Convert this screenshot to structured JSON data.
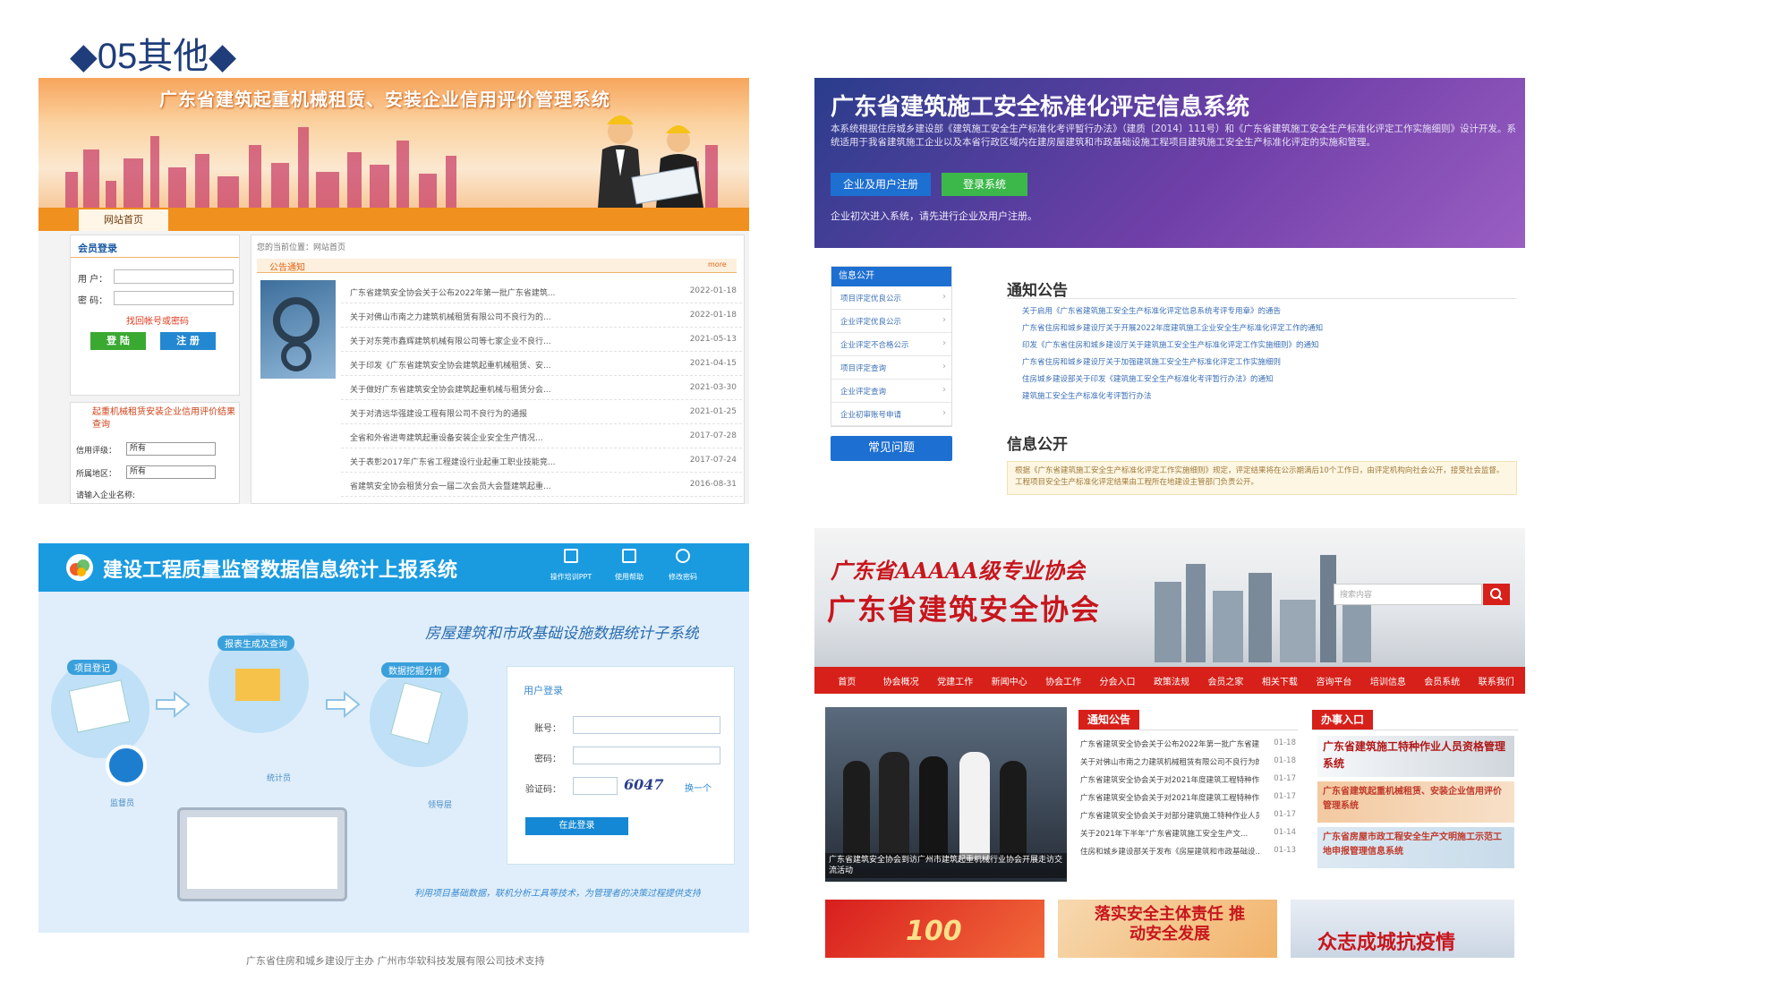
{
  "slide": {
    "title": "◆05其他◆"
  },
  "p1": {
    "banner_title": "广东省建筑起重机械租赁、安装企业信用评价管理系统",
    "nav_tab": "网站首页",
    "login_title": "会员登录",
    "user_label": "用 户：",
    "pwd_label": "密 码：",
    "forgot": "找回帐号或密码",
    "login_btn": "登 陆",
    "register_btn": "注 册",
    "query_title": "起重机械租赁安装企业信用评价结果查询",
    "rating_label": "信用评级：",
    "rating_value": "所有",
    "region_label": "所属地区：",
    "region_value": "所有",
    "company_label": "请输入企业名称:",
    "breadcrumb": "您的当前位置：网站首页",
    "notice_tab": "公告通知",
    "more": "more",
    "news": [
      {
        "title": "广东省建筑安全协会关于公布2022年第一批广东省建筑...",
        "date": "2022-01-18"
      },
      {
        "title": "关于对佛山市南之力建筑机械租赁有限公司不良行为的...",
        "date": "2022-01-18"
      },
      {
        "title": "关于对东莞市鑫辉建筑机械有限公司等七家企业不良行...",
        "date": "2021-05-13"
      },
      {
        "title": "关于印发《广东省建筑安全协会建筑起重机械租赁、安...",
        "date": "2021-04-15"
      },
      {
        "title": "关于做好广东省建筑安全协会建筑起重机械与租赁分会...",
        "date": "2021-03-30"
      },
      {
        "title": "关于对清远华强建设工程有限公司不良行为的通报",
        "date": "2021-01-25"
      },
      {
        "title": "全省和外省进粤建筑起重设备安装企业安全生产情况...",
        "date": "2017-07-28"
      },
      {
        "title": "关于表彰2017年广东省工程建设行业起重工职业技能竞...",
        "date": "2017-07-24"
      },
      {
        "title": "省建筑安全协会租赁分会一届二次会员大会暨建筑起重...",
        "date": "2016-08-31"
      }
    ]
  },
  "p2": {
    "title": "广东省建筑施工安全标准化评定信息系统",
    "desc": "本系统根据住房城乡建设部《建筑施工安全生产标准化考评暂行办法》（建质〔2014〕111号）和《广东省建筑施工安全生产标准化评定工作实施细则》设计开发。系统适用于我省建筑施工企业以及本省行政区域内在建房屋建筑和市政基础设施工程项目建筑施工安全生产标准化评定的实施和管理。",
    "btn_register": "企业及用户注册",
    "btn_login": "登录系统",
    "hint": "企业初次进入系统，请先进行企业及用户注册。",
    "side_head": "信息公开",
    "side_items": [
      "项目评定优良公示",
      "企业评定优良公示",
      "企业评定不合格公示",
      "项目评定查询",
      "企业评定查询",
      "企业初审账号申请"
    ],
    "faq_btn": "常见问题",
    "notice_title": "通知公告",
    "notices": [
      "关于启用《广东省建筑施工安全生产标准化评定信息系统考评专用章》的通告",
      "广东省住房和城乡建设厅关于开展2022年度建筑施工企业安全生产标准化评定工作的通知",
      "印发《广东省住房和城乡建设厅关于建筑施工安全生产标准化评定工作实施细则》的通知",
      "广东省住房和城乡建设厅关于加强建筑施工安全生产标准化评定工作实施细则",
      "住房城乡建设部关于印发《建筑施工安全生产标准化考评暂行办法》的通知",
      "建筑施工安全生产标准化考评暂行办法"
    ],
    "info_title": "信息公开",
    "info_text": "根据《广东省建筑施工安全生产标准化评定工作实施细则》规定，评定结果将在公示期满后10个工作日，由评定机构向社会公开，接受社会监督。工程项目安全生产标准化评定结果由工程所在地建设主管部门负责公开。"
  },
  "p3": {
    "title": "建设工程质量监督数据信息统计上报系统",
    "toolbar": [
      "操作培训PPT",
      "使用帮助",
      "修改密码"
    ],
    "subsystem": "房屋建筑和市政基础设施数据统计子系统",
    "steps": [
      "项目登记",
      "报表生成及查询",
      "数据挖掘分析"
    ],
    "roles": [
      "监督员",
      "统计员",
      "领导层"
    ],
    "login_title": "用户登录",
    "account_label": "账号：",
    "pwd_label": "密码：",
    "captcha_label": "验证码：",
    "captcha": "6047",
    "refresh": "换一个",
    "login_btn": "在此登录",
    "slogan": "利用项目基础数据，联机分析工具等技术，为管理者的决策过程提供支持",
    "footer": "广东省住房和城乡建设厅主办 广州市华软科技发展有限公司技术支持"
  },
  "p4": {
    "slogan": "广东省AAAAA级专业协会",
    "title": "广东省建筑安全协会",
    "search_placeholder": "搜索内容",
    "nav": [
      "首页",
      "协会概况",
      "党建工作",
      "新闻中心",
      "协会工作",
      "分会入口",
      "政策法规",
      "会员之家",
      "相关下载",
      "咨询平台",
      "培训信息",
      "会员系统",
      "联系我们"
    ],
    "photo_caption": "广东省建筑安全协会到访广州市建筑起重机械行业协会开展走访交流活动",
    "notice_head": "通知公告",
    "notices": [
      {
        "title": "广东省建筑安全协会关于公布2022年第一批广东省建...",
        "date": "01-18"
      },
      {
        "title": "关于对佛山市南之力建筑机械租赁有限公司不良行为的...",
        "date": "01-18"
      },
      {
        "title": "广东省建筑安全协会关于对2021年度建筑工程特种作...",
        "date": "01-17"
      },
      {
        "title": "广东省建筑安全协会关于对2021年度建筑工程特种作...",
        "date": "01-17"
      },
      {
        "title": "广东省建筑安全协会关于对部分建筑施工特种作业人员...",
        "date": "01-17"
      },
      {
        "title": "关于2021年下半年“广东省建筑施工安全生产文...",
        "date": "01-14"
      },
      {
        "title": "住房和城乡建设部关于发布《房屋建筑和市政基础设...",
        "date": "01-13"
      }
    ],
    "entry_head": "办事入口",
    "entries": [
      "广东省建筑施工特种作业人员资格管理系统",
      "广东省建筑起重机械租赁、安装企业信用评价管理系统",
      "广东省房屋市政工程安全生产文明施工示范工地申报管理信息系统"
    ],
    "bottom_banners": [
      "100",
      "落实安全主体责任 推动安全发展",
      "众志成城抗疫情"
    ]
  },
  "colors": {
    "title": "#1f3d7a",
    "orange": "#f0901e",
    "purple": "#5b3fa0",
    "blue": "#1a9be0",
    "red": "#d7201a"
  }
}
